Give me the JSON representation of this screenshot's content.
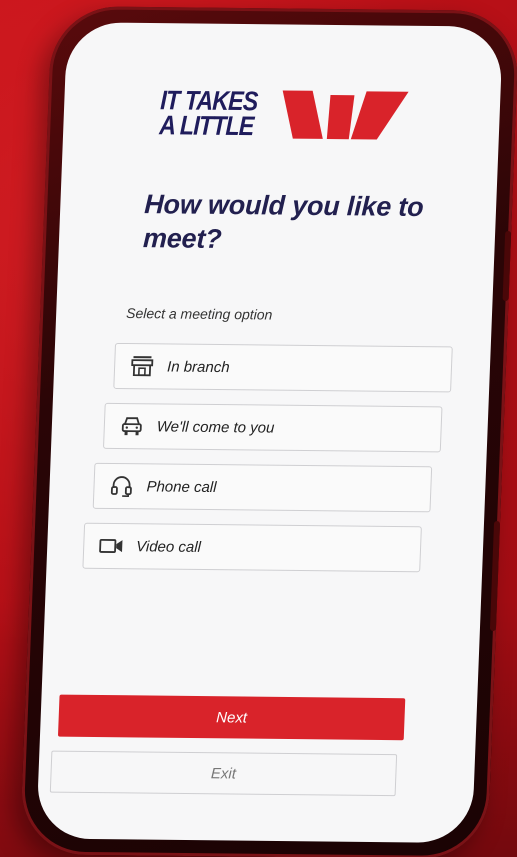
{
  "brand": {
    "logo_line1": "IT TAKES",
    "logo_line2": "A LITTLE",
    "primary_color": "#d9232a",
    "navy_color": "#22204f"
  },
  "screen": {
    "headline": "How would you like to meet?",
    "subtitle": "Select a meeting option",
    "options": [
      {
        "label": "In branch",
        "icon": "storefront-icon"
      },
      {
        "label": "We'll come to you",
        "icon": "car-icon"
      },
      {
        "label": "Phone call",
        "icon": "headset-icon"
      },
      {
        "label": "Video call",
        "icon": "video-camera-icon"
      }
    ],
    "next_label": "Next",
    "exit_label": "Exit"
  }
}
